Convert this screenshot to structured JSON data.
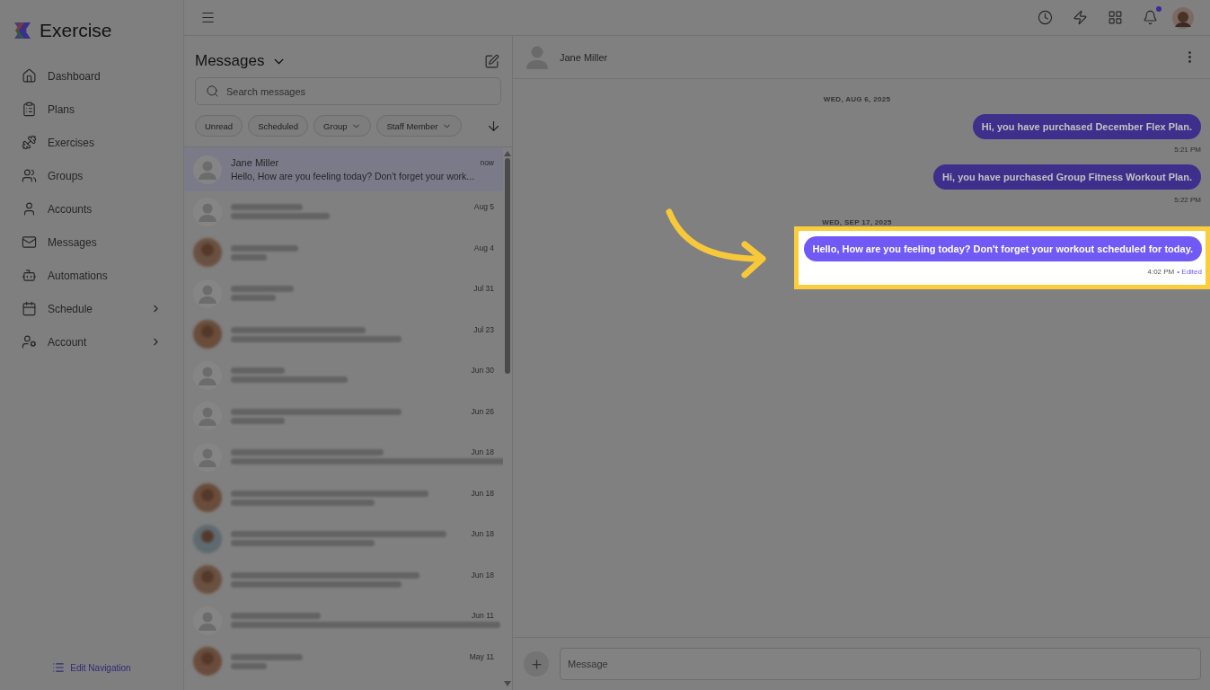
{
  "app": {
    "name": "Exercise"
  },
  "sidebar": {
    "items": [
      {
        "label": "Dashboard",
        "expandable": false
      },
      {
        "label": "Plans",
        "expandable": false
      },
      {
        "label": "Exercises",
        "expandable": false
      },
      {
        "label": "Groups",
        "expandable": false
      },
      {
        "label": "Accounts",
        "expandable": false
      },
      {
        "label": "Messages",
        "expandable": false
      },
      {
        "label": "Automations",
        "expandable": false
      },
      {
        "label": "Schedule",
        "expandable": true
      },
      {
        "label": "Account",
        "expandable": true
      }
    ],
    "footer_link": "Edit Navigation"
  },
  "top_bar": {
    "notifications_unread": true
  },
  "inbox": {
    "title": "Messages",
    "search": {
      "placeholder": "Search messages"
    },
    "filters": [
      {
        "label": "Unread",
        "dropdown": false
      },
      {
        "label": "Scheduled",
        "dropdown": false
      },
      {
        "label": "Group",
        "dropdown": true
      },
      {
        "label": "Staff Member",
        "dropdown": true
      }
    ],
    "conversations": [
      {
        "name": "Jane Miller",
        "preview": "Hello, How are you feeling today? Don't forget your work...",
        "time": "now",
        "kind": "default",
        "selected": true
      },
      {
        "time": "Aug 5",
        "kind": "default",
        "selected": false
      },
      {
        "time": "Aug 4",
        "kind": "photo",
        "selected": false
      },
      {
        "time": "Jul 31",
        "kind": "default",
        "selected": false
      },
      {
        "time": "Jul 23",
        "kind": "photo",
        "selected": false
      },
      {
        "time": "Jun 30",
        "kind": "default",
        "selected": false
      },
      {
        "time": "Jun 26",
        "kind": "default",
        "selected": false
      },
      {
        "time": "Jun 18",
        "kind": "default",
        "selected": false
      },
      {
        "time": "Jun 18",
        "kind": "photo",
        "selected": false
      },
      {
        "time": "Jun 18",
        "kind": "photo",
        "selected": false
      },
      {
        "time": "Jun 18",
        "kind": "photo",
        "selected": false
      },
      {
        "time": "Jun 11",
        "kind": "default",
        "selected": false
      },
      {
        "time": "May 11",
        "kind": "photo",
        "selected": false
      }
    ]
  },
  "chat": {
    "contact": "Jane Miller",
    "days": [
      {
        "date": "WED, AUG 6, 2025",
        "messages": [
          {
            "text": "Hi, you have purchased December Flex Plan.",
            "time": "5:21 PM",
            "highlighted": false
          },
          {
            "text": "Hi, you have purchased Group Fitness Workout Plan.",
            "time": "5:22 PM",
            "highlighted": false
          }
        ]
      },
      {
        "date": "WED, SEP 17, 2025",
        "messages": [
          {
            "text": "Hello, How are you feeling today? Don't forget your workout scheduled for today.",
            "time": "4:02 PM",
            "status": "• Edited",
            "highlighted": true
          }
        ]
      }
    ],
    "composer": {
      "placeholder": "Message"
    }
  }
}
